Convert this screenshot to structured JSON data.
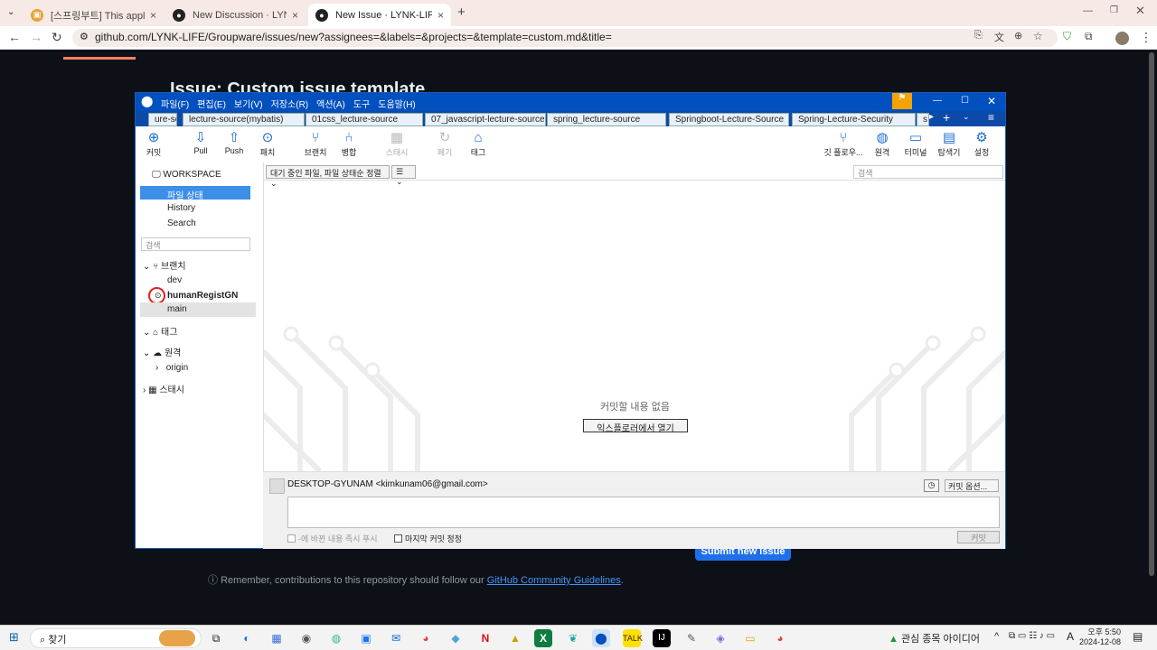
{
  "browser": {
    "tabs": [
      {
        "title": "[스프링부트] This application h",
        "active": false
      },
      {
        "title": "New Discussion · LYNK-LIFE",
        "active": false
      },
      {
        "title": "New Issue · LYNK-LIFE/Groupw",
        "active": true
      }
    ],
    "new_tab": "+",
    "url": "github.com/LYNK-LIFE/Groupware/issues/new?assignees=&labels=&projects=&template=custom.md&title="
  },
  "github": {
    "title": "Issue: Custom issue template",
    "submit_label": "Submit new issue",
    "note_prefix": "Remember, contributions to this repository should follow our",
    "note_link": "GitHub Community Guidelines",
    "note_suffix": "."
  },
  "sourcetree": {
    "menu": [
      "파일(F)",
      "편집(E)",
      "보기(V)",
      "저장소(R)",
      "액션(A)",
      "도구",
      "도움말(H)"
    ],
    "repo_tabs": [
      "ure-so...",
      "lecture-source(mybatis)",
      "01css_lecture-source",
      "07_javascript-lecture-source",
      "spring_lecture-source",
      "Springboot-Lecture-Source",
      "Spring-Lecture-Security",
      "s"
    ],
    "toolbar_left": [
      {
        "label": "커밋",
        "icon": "commit-icon",
        "disabled": false
      },
      {
        "label": "Pull",
        "icon": "pull-icon",
        "disabled": false
      },
      {
        "label": "Push",
        "icon": "push-icon",
        "disabled": false
      },
      {
        "label": "패치",
        "icon": "fetch-icon",
        "disabled": false
      },
      {
        "label": "브랜치",
        "icon": "branch-icon",
        "disabled": false
      },
      {
        "label": "병합",
        "icon": "merge-icon",
        "disabled": false
      },
      {
        "label": "스태시",
        "icon": "stash-icon",
        "disabled": true
      },
      {
        "label": "폐기",
        "icon": "discard-icon",
        "disabled": true
      },
      {
        "label": "태그",
        "icon": "tag-icon",
        "disabled": false
      }
    ],
    "toolbar_right": [
      {
        "label": "깃 플로우...",
        "icon": "git-flow-icon"
      },
      {
        "label": "원격",
        "icon": "remote-icon"
      },
      {
        "label": "터미널",
        "icon": "terminal-icon"
      },
      {
        "label": "탐색기",
        "icon": "explorer-icon"
      },
      {
        "label": "설정",
        "icon": "settings-icon"
      }
    ],
    "sidebar": {
      "workspace": "WORKSPACE",
      "file_status": "파일 상태",
      "history": "History",
      "search": "Search",
      "search_placeholder": "검색",
      "branches_header": "브랜치",
      "branches": [
        "dev",
        "humanRegistGN",
        "main"
      ],
      "tags_header": "태그",
      "remotes_header": "원격",
      "remotes": [
        "origin"
      ],
      "stash_header": "스태시"
    },
    "filter_dropdown": "대기 중인 파일, 파일 상태순 정렬",
    "view_dropdown": "☰",
    "main_search_placeholder": "검색",
    "empty_message": "커밋할 내용 없음",
    "open_explorer": "익스플로러에서 열기",
    "author": "DESKTOP-GYUNAM <kimkunam06@gmail.com>",
    "commit_options": "커밋 옵션...",
    "push_immediately": "-에 바뀐 내용 즉시 푸시",
    "amend_last": "마지막 커밋 정정",
    "commit_button": "커밋"
  },
  "taskbar": {
    "search": "찾기",
    "stock_widget": "관심 종목 아이디어",
    "lang": "A",
    "time": "오후 5:50",
    "date": "2024-12-08"
  },
  "colors": {
    "accent": "#0050c0",
    "github_bg": "#0d1117",
    "selected": "#3d8ee8"
  }
}
